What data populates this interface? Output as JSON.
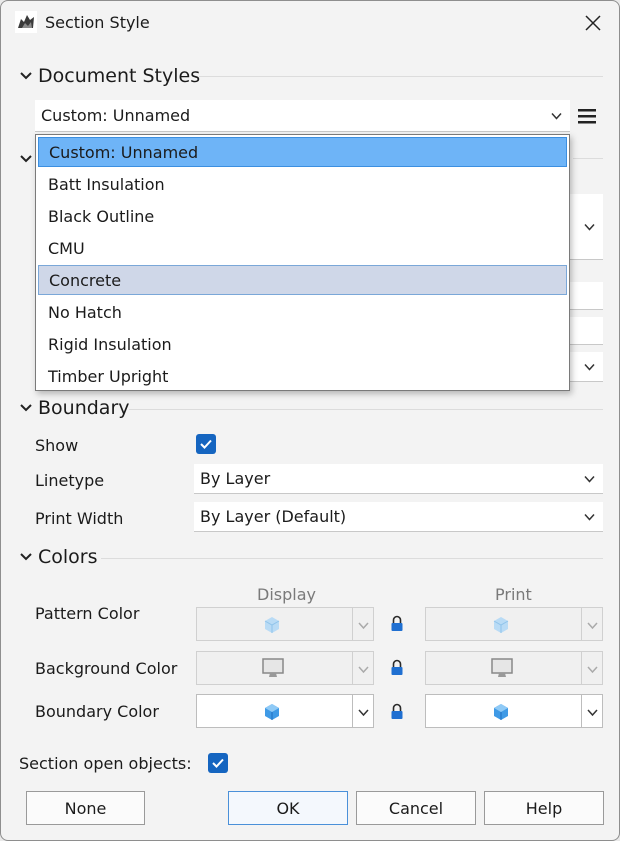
{
  "window": {
    "title": "Section Style"
  },
  "document_styles": {
    "heading": "Document Styles",
    "selected": "Custom: Unnamed",
    "options": [
      "Custom: Unnamed",
      "Batt Insulation",
      "Black Outline",
      "CMU",
      "Concrete",
      "No Hatch",
      "Rigid Insulation",
      "Timber Upright"
    ],
    "selected_index": 0,
    "hover_index": 4
  },
  "boundary": {
    "heading": "Boundary",
    "show_label": "Show",
    "show_checked": true,
    "linetype_label": "Linetype",
    "linetype_value": "By Layer",
    "print_width_label": "Print Width",
    "print_width_value": "By Layer (Default)"
  },
  "colors": {
    "heading": "Colors",
    "display_header": "Display",
    "print_header": "Print",
    "rows": [
      {
        "label": "Pattern Color",
        "display_icon": "cube-icon-light",
        "print_icon": "cube-icon-light",
        "enabled": false
      },
      {
        "label": "Background Color",
        "display_icon": "monitor-icon",
        "print_icon": "monitor-icon",
        "enabled": false
      },
      {
        "label": "Boundary Color",
        "display_icon": "cube-icon-blue",
        "print_icon": "cube-icon-blue",
        "enabled": true
      }
    ]
  },
  "section_open_objects": {
    "label": "Section open objects:",
    "checked": true
  },
  "buttons": {
    "none": "None",
    "ok": "OK",
    "cancel": "Cancel",
    "help": "Help"
  }
}
